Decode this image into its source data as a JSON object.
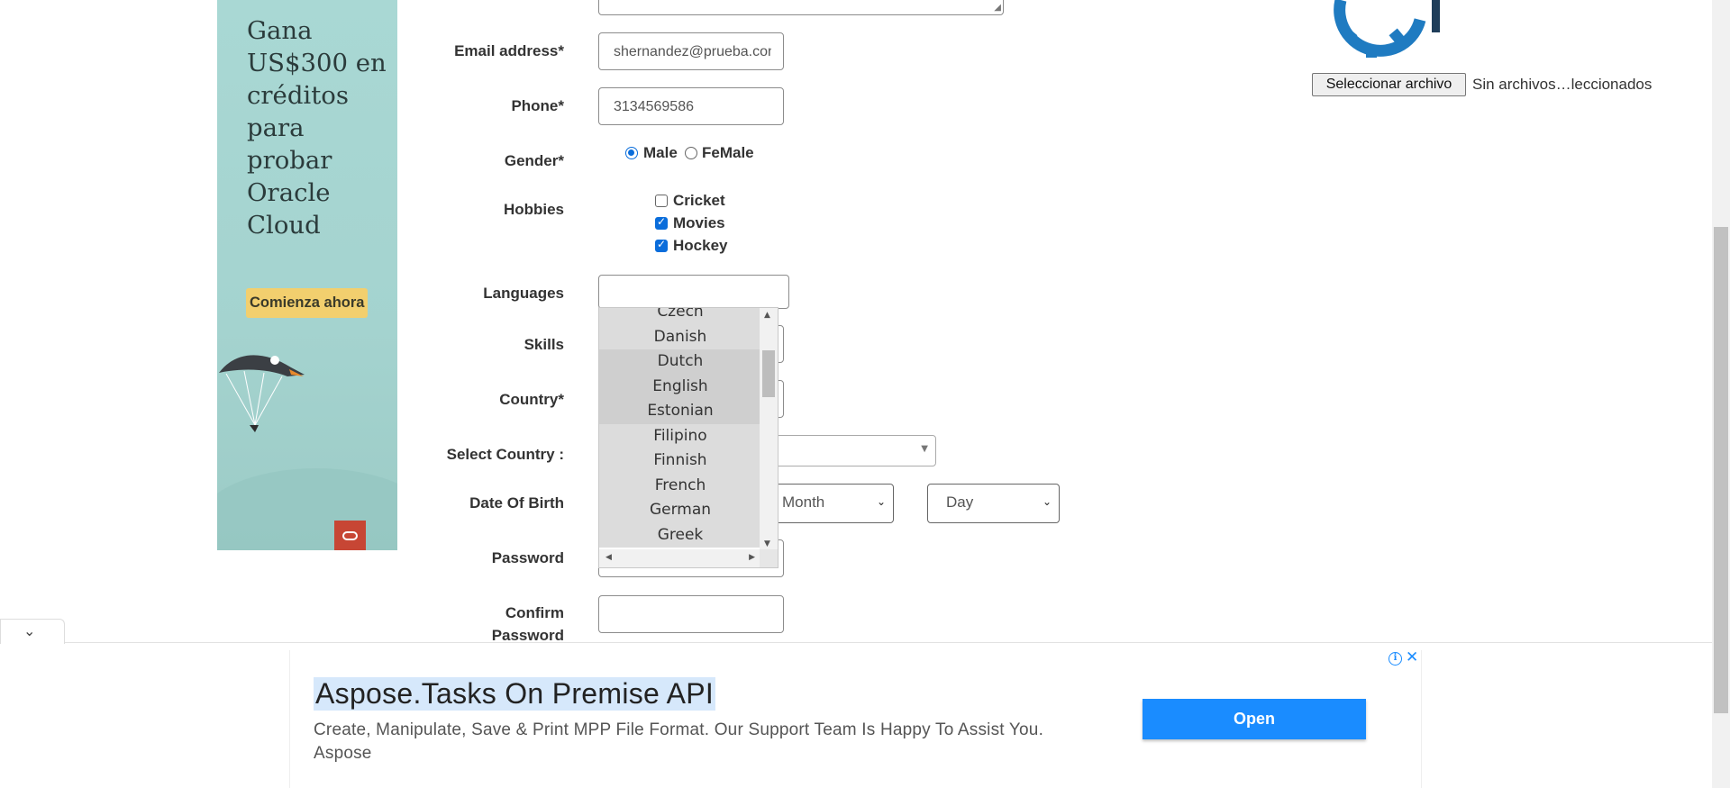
{
  "side_ad": {
    "headline": "Gana US$300 en créditos para probar Oracle Cloud",
    "cta": "Comienza ahora"
  },
  "form": {
    "email": {
      "label": "Email address*",
      "value": "shernandez@prueba.com"
    },
    "phone": {
      "label": "Phone*",
      "value": "3134569586"
    },
    "gender": {
      "label": "Gender*",
      "options": [
        "Male",
        "FeMale"
      ],
      "selected": "Male"
    },
    "hobbies": {
      "label": "Hobbies",
      "options": [
        {
          "label": "Cricket",
          "checked": false
        },
        {
          "label": "Movies",
          "checked": true
        },
        {
          "label": "Hockey",
          "checked": true
        }
      ]
    },
    "languages": {
      "label": "Languages",
      "value": ""
    },
    "skills": {
      "label": "Skills"
    },
    "country": {
      "label": "Country*"
    },
    "select_country": {
      "label": "Select Country :"
    },
    "dob": {
      "label": "Date Of Birth",
      "month": "Month",
      "day": "Day"
    },
    "password": {
      "label": "Password"
    },
    "confirm_password": {
      "label_line1": "Confirm",
      "label_line2": "Password"
    }
  },
  "language_dropdown": {
    "items": [
      "Czech",
      "Danish",
      "Dutch",
      "English",
      "Estonian",
      "Filipino",
      "Finnish",
      "French",
      "German",
      "Greek"
    ],
    "selected": [
      "Dutch",
      "English",
      "Estonian"
    ]
  },
  "file_upload": {
    "button_label": "Seleccionar archivo",
    "status": "Sin archivos…leccionados"
  },
  "bottom_ad": {
    "title": "Aspose.Tasks On Premise API",
    "description": "Create, Manipulate, Save & Print MPP File Format. Our Support Team Is Happy To Assist You.",
    "advertiser": "Aspose",
    "open_label": "Open",
    "info_icon": "info-icon",
    "close_icon": "close-icon"
  },
  "colors": {
    "accent": "#0a6ddb",
    "ad_button": "#1a8cff",
    "oracle_red": "#c74634",
    "ad_teal": "#a9d8d4"
  }
}
